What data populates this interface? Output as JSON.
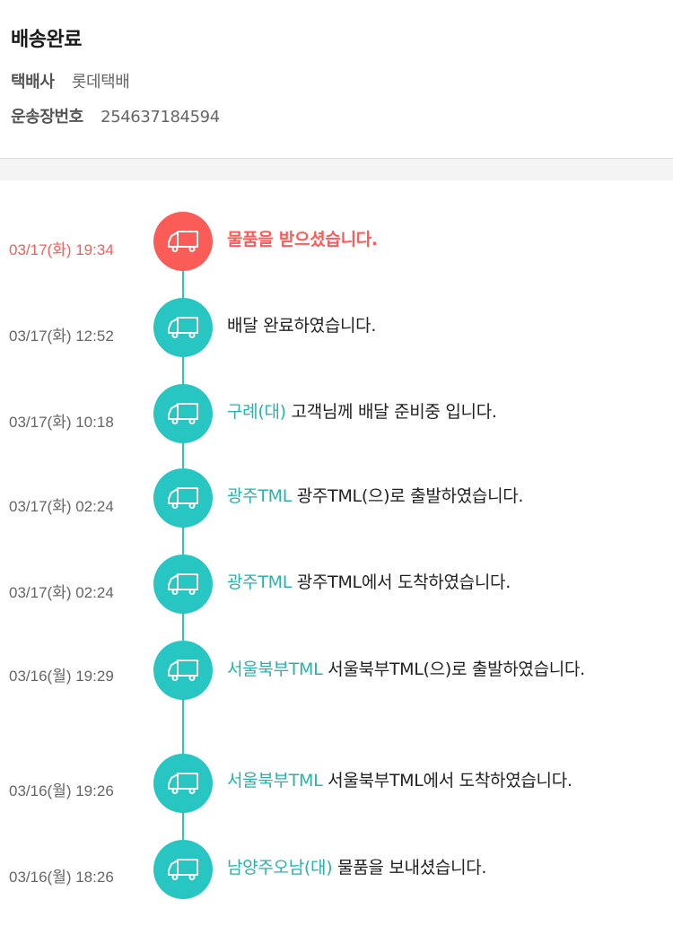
{
  "header": {
    "status": "배송완료",
    "carrier_label": "택배사",
    "carrier_value": "롯데택배",
    "invoice_label": "운송장번호",
    "invoice_value": "254637184594"
  },
  "colors": {
    "accent": "#27c6c3",
    "active": "#fb5c58",
    "location_text": "#27b2ad"
  },
  "events": [
    {
      "time": "03/17(화) 19:34",
      "location": "",
      "message": "물품을 받으셨습니다.",
      "active": true,
      "icon": "delivery-truck-icon"
    },
    {
      "time": "03/17(화) 12:52",
      "location": "",
      "message": "배달 완료하였습니다.",
      "active": false,
      "icon": "delivery-truck-icon"
    },
    {
      "time": "03/17(화) 10:18",
      "location": "구례(대)",
      "message": "고객님께 배달 준비중 입니다.",
      "active": false,
      "icon": "delivery-truck-icon"
    },
    {
      "time": "03/17(화) 02:24",
      "location": "광주TML",
      "message": "광주TML(으)로 출발하였습니다.",
      "active": false,
      "icon": "delivery-truck-icon"
    },
    {
      "time": "03/17(화) 02:24",
      "location": "광주TML",
      "message": "광주TML에서 도착하였습니다.",
      "active": false,
      "icon": "delivery-truck-icon"
    },
    {
      "time": "03/16(월) 19:29",
      "location": "서울북부TML",
      "message": "서울북부TML(으)로 출발하였습니다.",
      "active": false,
      "icon": "delivery-truck-icon"
    },
    {
      "time": "03/16(월) 19:26",
      "location": "서울북부TML",
      "message": "서울북부TML에서 도착하였습니다.",
      "active": false,
      "icon": "delivery-truck-icon"
    },
    {
      "time": "03/16(월) 18:26",
      "location": "남양주오남(대)",
      "message": "물품을 보내셨습니다.",
      "active": false,
      "icon": "delivery-truck-icon"
    }
  ]
}
